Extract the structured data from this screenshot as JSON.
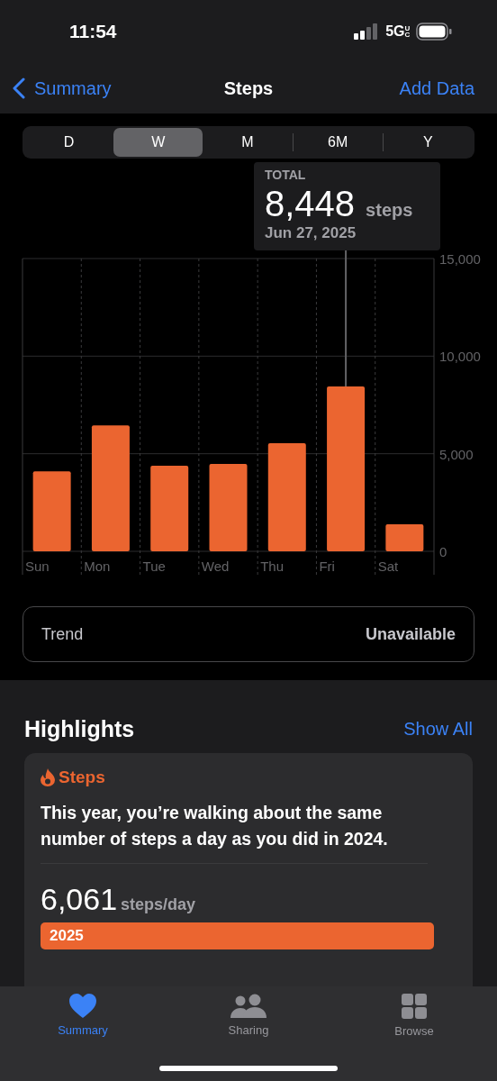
{
  "status_bar": {
    "time": "11:54",
    "network": "5G",
    "network_suffix": "UC"
  },
  "nav": {
    "back": "Summary",
    "title": "Steps",
    "action": "Add Data"
  },
  "periods": [
    {
      "label": "D",
      "selected": false
    },
    {
      "label": "W",
      "selected": true
    },
    {
      "label": "M",
      "selected": false
    },
    {
      "label": "6M",
      "selected": false
    },
    {
      "label": "Y",
      "selected": false
    }
  ],
  "tooltip": {
    "label": "TOTAL",
    "value": "8,448",
    "unit": "steps",
    "date": "Jun 27, 2025"
  },
  "chart_data": {
    "type": "bar",
    "categories": [
      "Sun",
      "Mon",
      "Tue",
      "Wed",
      "Thu",
      "Fri",
      "Sat"
    ],
    "series": [
      {
        "color": "#eb6530",
        "values": [
          4100,
          6450,
          4380,
          4480,
          5540,
          8448,
          1380
        ]
      }
    ],
    "ylim": [
      0,
      15000
    ],
    "yticks": [
      {
        "value": 0,
        "label": "0"
      },
      {
        "value": 5000,
        "label": "5,000"
      },
      {
        "value": 10000,
        "label": "10,000"
      },
      {
        "value": 15000,
        "label": "15,000"
      }
    ]
  },
  "trend": {
    "label": "Trend",
    "value": "Unavailable"
  },
  "highlights": {
    "title": "Highlights",
    "action": "Show All",
    "card": {
      "title": "Steps",
      "text": "This year, you’re walking about the same number of steps a day as you did in 2024.",
      "rows": [
        {
          "value": "6,061",
          "unit": "steps/day",
          "bar_label": "2025"
        }
      ]
    }
  },
  "tab_bar": [
    {
      "label": "Summary",
      "kind": "heart",
      "selected": true
    },
    {
      "label": "Sharing",
      "kind": "people",
      "selected": false
    },
    {
      "label": "Browse",
      "kind": "grid",
      "selected": false
    }
  ]
}
